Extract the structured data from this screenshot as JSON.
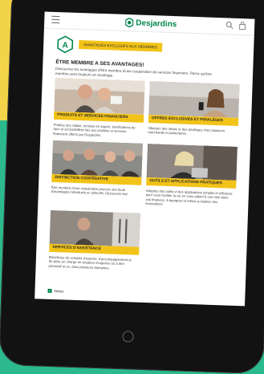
{
  "colors": {
    "brand_green": "#00874e",
    "accent_yellow": "#f2c318",
    "page_bg": "#2bb98d",
    "bg_yellow": "#f3d448"
  },
  "header": {
    "brand_name": "Desjardins",
    "menu_icon": "hamburger-menu-icon",
    "search_icon": "search-icon",
    "cart_icon": "cart-icon",
    "logo_icon": "desjardins-hexagon-logo"
  },
  "hero": {
    "badge_letter": "A",
    "banner": "AVANTAGES EXCLUSIFS AUX MEMBRES"
  },
  "section": {
    "title": "ÊTRE MEMBRE A SES AVANTAGES!",
    "intro": "Découvrez les avantages d'être membre d'une coopérative de services financiers. Parce qu'être membre sera toujours un avantage."
  },
  "cards": [
    {
      "title": "PRODUITS ET SERVICES FINANCIERS",
      "description": "Profitez des rabais, remises en argent, bonifications de taux et accessibilités liés aux produits et services financiers offerts par Desjardins."
    },
    {
      "title": "OFFRES EXCLUSIVES ET PRIVILÈGES",
      "description": "Obtenez des rabais et des privilèges chez plusieurs marchands et partenaires."
    },
    {
      "title": "DISTINCTION COOPÉRATIVE",
      "description": "Être membre d'une coopérative procure une foule d'avantages individuels et collectifs. Découvrez-les!"
    },
    {
      "title": "OUTILS ET APPLICATIONS PRATIQUES",
      "description": "Adoptez des outils et des applications simples et efficaces pour vous faciliter la vie en vous aidant à voir clair dans vos finances, à épargner et même à réaliser des économies!"
    },
    {
      "title": "SERVICES D'ASSISTANCE",
      "description": "Bénéficiez de conseils d'experts, d'accompagnement et de prise en charge en situation d'urgence ou à titre préventif et ce, dans plusieurs domaines."
    }
  ],
  "footer": {
    "notes_label": "Notes",
    "notes_icon": "plus-icon"
  }
}
